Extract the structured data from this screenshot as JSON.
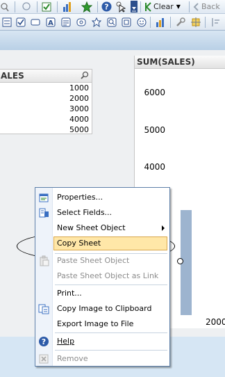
{
  "toolbar_top": {
    "clear_label": "Clear",
    "back_label": "Back",
    "icons": [
      "search-icon",
      "check-icon",
      "chart-icon",
      "star-icon",
      "help-icon",
      "pointer-icon",
      "dropdown-icon",
      "clear-icon",
      "back-icon"
    ]
  },
  "toolbar_design": {
    "icons": [
      "list-icon",
      "checkbox-icon",
      "button-icon",
      "text-icon",
      "lines-icon",
      "currency-icon",
      "bookmark-icon",
      "search-object-icon",
      "container-icon",
      "smiley-icon",
      "chart-wizard-icon",
      "wrench-icon",
      "grid-icon",
      "layout-icon"
    ]
  },
  "listbox": {
    "title": "ALES",
    "values": [
      "1000",
      "2000",
      "3000",
      "4000",
      "5000"
    ]
  },
  "chart": {
    "title": "SUM(SALES)",
    "x_tick": "2000"
  },
  "chart_data": {
    "type": "bar",
    "title": "SUM(SALES)",
    "categories": [
      "2000"
    ],
    "y_ticks": [
      6000,
      5000,
      4000
    ],
    "ylim": [
      3000,
      6000
    ],
    "values": [
      2860
    ],
    "grid": false
  },
  "context_menu": {
    "items": [
      {
        "label": "Properties...",
        "icon": "properties-icon",
        "enabled": true
      },
      {
        "label": "Select Fields...",
        "icon": "select-fields-icon",
        "enabled": true
      },
      {
        "label": "New Sheet Object",
        "icon": "",
        "enabled": true,
        "submenu": true
      },
      {
        "label": "Copy Sheet",
        "icon": "",
        "enabled": true,
        "selected": true
      },
      {
        "label": "Paste Sheet Object",
        "icon": "paste-icon",
        "enabled": false
      },
      {
        "label": "Paste Sheet Object as Link",
        "icon": "",
        "enabled": false
      },
      {
        "label": "Print...",
        "icon": "",
        "enabled": true
      },
      {
        "label": "Copy Image to Clipboard",
        "icon": "copy-image-icon",
        "enabled": true
      },
      {
        "label": "Export Image to File",
        "icon": "",
        "enabled": true
      },
      {
        "label": "Help",
        "icon": "help-icon",
        "enabled": true
      },
      {
        "label": "Remove",
        "icon": "remove-icon",
        "enabled": false
      }
    ]
  }
}
